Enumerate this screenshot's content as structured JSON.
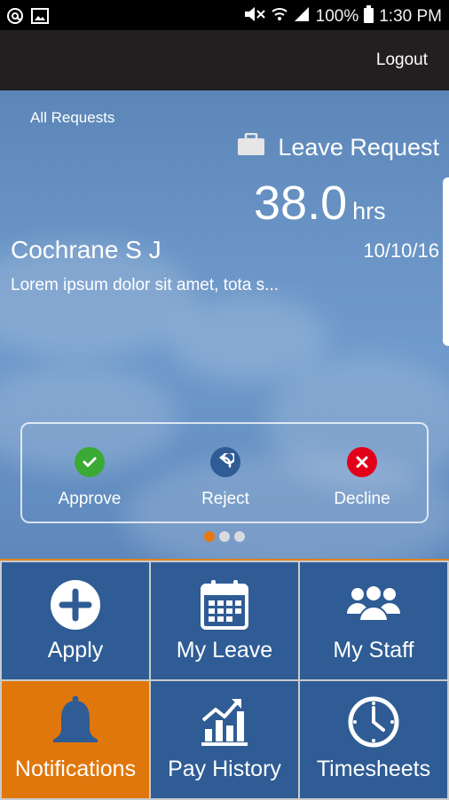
{
  "status_bar": {
    "battery": "100%",
    "time": "1:30 PM",
    "icons": [
      "at-icon",
      "image-icon",
      "mute-icon",
      "wifi-icon",
      "signal-icon",
      "battery-icon"
    ]
  },
  "app_bar": {
    "logout_label": "Logout"
  },
  "request": {
    "all_requests_label": "All Requests",
    "type_label": "Leave Request",
    "hours_value": "38.0",
    "hours_unit": "hrs",
    "employee_name": "Cochrane S J",
    "date": "10/10/16",
    "description": "Lorem ipsum dolor sit amet, tota s..."
  },
  "actions": [
    {
      "label": "Approve",
      "icon": "check-icon",
      "color": "#3aaa35"
    },
    {
      "label": "Reject",
      "icon": "undo-icon",
      "color": "#2f5c94"
    },
    {
      "label": "Decline",
      "icon": "close-icon",
      "color": "#e3001b"
    }
  ],
  "pager": {
    "total": 3,
    "active": 1
  },
  "menu": [
    {
      "label": "Apply",
      "icon": "plus-circle-icon"
    },
    {
      "label": "My Leave",
      "icon": "calendar-icon"
    },
    {
      "label": "My Staff",
      "icon": "people-icon"
    },
    {
      "label": "Notifications",
      "icon": "bell-icon",
      "active": true
    },
    {
      "label": "Pay History",
      "icon": "chart-icon"
    },
    {
      "label": "Timesheets",
      "icon": "clock-icon"
    }
  ],
  "colors": {
    "accent": "#e0770c",
    "tile": "#2f5c94",
    "app_bar": "#231f20"
  }
}
